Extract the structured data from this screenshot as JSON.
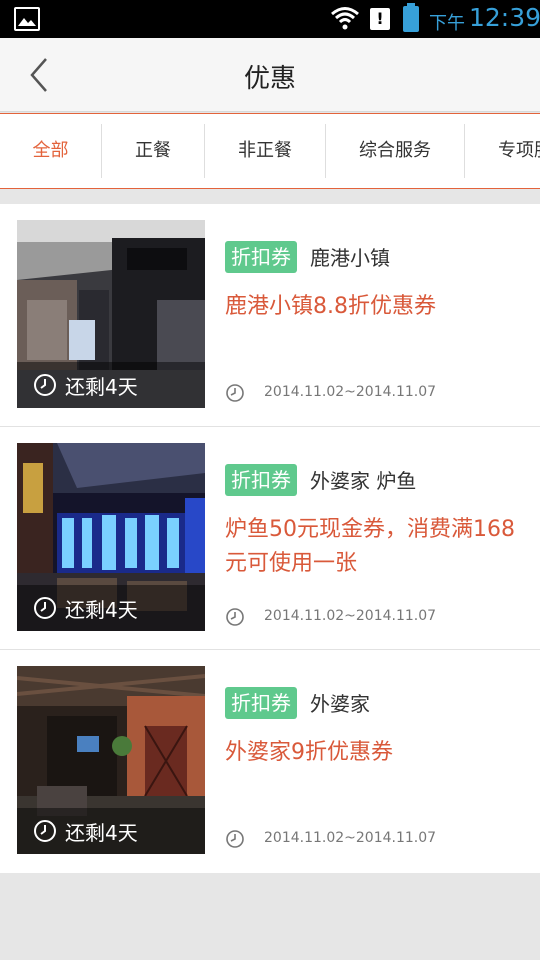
{
  "status_bar": {
    "ampm": "下午",
    "time": "12:39",
    "icons": [
      "gallery-icon",
      "wifi-icon",
      "notification-icon",
      "battery-icon"
    ]
  },
  "header": {
    "title": "优惠",
    "back_icon": "chevron-left-icon"
  },
  "tabs": [
    {
      "label": "全部",
      "active": true
    },
    {
      "label": "正餐",
      "active": false
    },
    {
      "label": "非正餐",
      "active": false
    },
    {
      "label": "综合服务",
      "active": false
    },
    {
      "label": "专项服",
      "active": false
    }
  ],
  "coupons": [
    {
      "remaining": "还剩4天",
      "tag": "折扣券",
      "shop": "鹿港小镇",
      "title": "鹿港小镇8.8折优惠券",
      "dates": "2014.11.02~2014.11.07"
    },
    {
      "remaining": "还剩4天",
      "tag": "折扣券",
      "shop": "外婆家 炉鱼",
      "title": "炉鱼50元现金券，消费满168元可使用一张",
      "dates": "2014.11.02~2014.11.07"
    },
    {
      "remaining": "还剩4天",
      "tag": "折扣券",
      "shop": "外婆家",
      "title": "外婆家9折优惠券",
      "dates": "2014.11.02~2014.11.07"
    }
  ],
  "colors": {
    "accent": "#e3633b",
    "deal_text": "#d9593a",
    "tag_bg": "#5fc98d",
    "status_text": "#37a0d9"
  }
}
